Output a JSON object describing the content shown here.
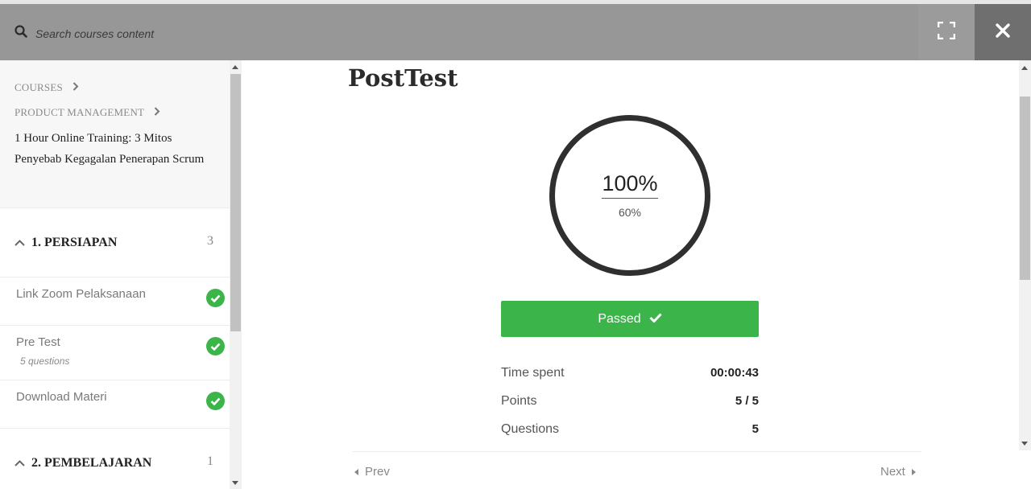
{
  "header": {
    "search_placeholder": "Search courses content"
  },
  "sidebar": {
    "breadcrumbs": [
      "COURSES",
      "PRODUCT MANAGEMENT"
    ],
    "course_title": "1 Hour Online Training: 3 Mitos Penyebab Kegagalan Penerapan Scrum",
    "sections": [
      {
        "label": "1. PERSIAPAN",
        "count": "3",
        "items": [
          {
            "title": "Link Zoom Pelaksanaan",
            "meta": "",
            "completed": true
          },
          {
            "title": "Pre Test",
            "meta": "5 questions",
            "completed": true
          },
          {
            "title": "Download Materi",
            "meta": "",
            "completed": true
          }
        ]
      },
      {
        "label": "2. PEMBELAJARAN",
        "count": "1",
        "items": []
      }
    ]
  },
  "main": {
    "title": "PostTest",
    "result_percent": "100%",
    "passing_percent": "60%",
    "status_label": "Passed",
    "stats": [
      {
        "label": "Time spent",
        "value": "00:00:43"
      },
      {
        "label": "Points",
        "value": "5 / 5"
      },
      {
        "label": "Questions",
        "value": "5"
      }
    ],
    "prev_label": "Prev",
    "next_label": "Next"
  },
  "colors": {
    "accent_green": "#3bb54a",
    "topbar": "#979797",
    "close_bg": "#6f6f6f"
  }
}
